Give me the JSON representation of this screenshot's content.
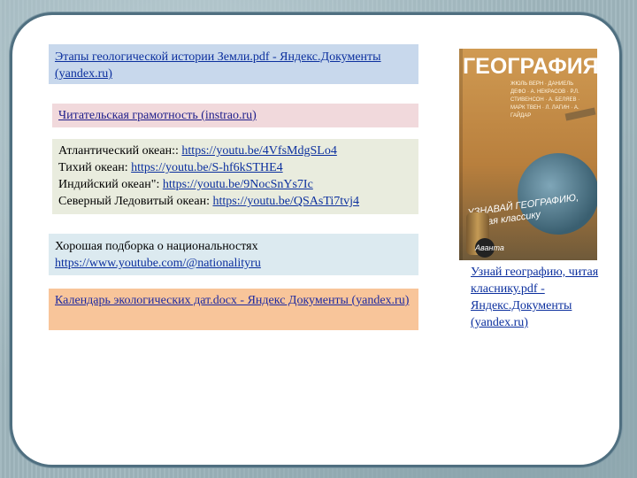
{
  "links": {
    "geology": "Этапы геологической  истории Земли.pdf - Яндекс.Документы (yandex.ru)",
    "literacy": "Читательская грамотность (instrao.ru)",
    "ecology": "Календарь экологических  дат.docx - Яндекс Документы (yandex.ru)",
    "book_caption": "Узнай географию, читая класнику.pdf  - Яндекс.Документы (yandex.ru)"
  },
  "oceans": [
    {
      "label": "Атлантический океан::",
      "url": "https://youtu.be/4VfsMdgSLo4"
    },
    {
      "label": "Тихий океан:",
      "url": "https://youtu.be/S-hf6kSTHE4"
    },
    {
      "label": "Индийский океан\":",
      "url": "https://youtu.be/9NocSnYs7Ic"
    },
    {
      "label": "Северный Ледовитый океан:",
      "url": "https://youtu.be/QSAsTi7tvj4"
    }
  ],
  "nationalities": {
    "text": "Хорошая  подборка о национальностях",
    "url": "https://www.youtube.com/@nationalityru"
  },
  "book": {
    "title": "ГЕОГРАФИЯ",
    "authors": "ЖЮЛЬ ВЕРН · ДАНИЕЛЬ ДЕФО · А. НЕКРАСОВ · Р.Л. СТИВЕНСОН · А. БЕЛЯЕВ · МАРК ТВЕН · Л. ЛАГИН · А. ГАЙДАР",
    "slogan": "УЗНАВАЙ ГЕОГРАФИЮ, читая классику",
    "publisher": "Аванта"
  },
  "colors": {
    "link": "#0b2f9e",
    "box_geology": "#c8d8ec",
    "box_literacy": "#f1d9dc",
    "box_oceans": "#e9ecde",
    "box_nationalities": "#dceaf0",
    "box_ecology": "#f8c59a",
    "frame": "#4f6f80"
  }
}
